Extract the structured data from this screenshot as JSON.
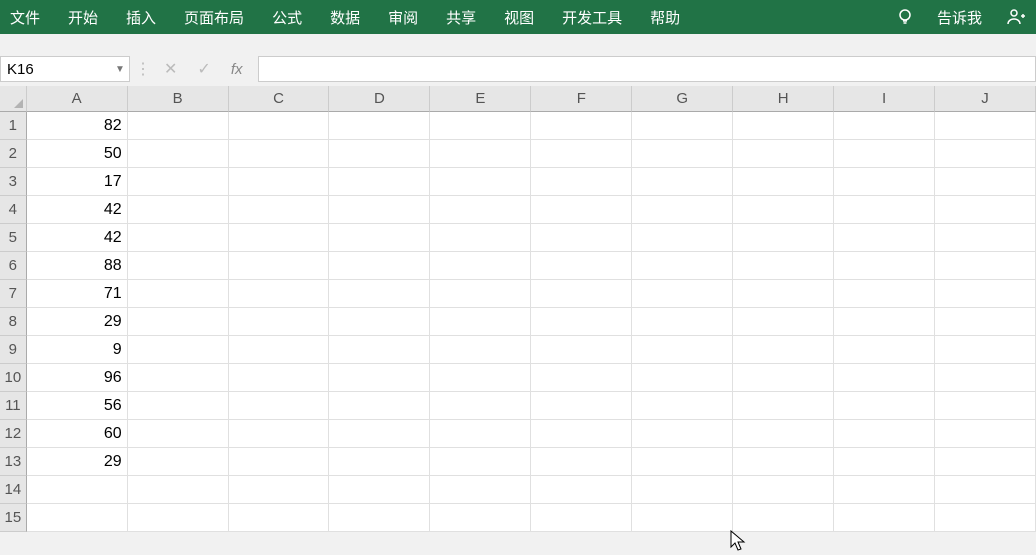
{
  "ribbon": {
    "tabs": [
      "文件",
      "开始",
      "插入",
      "页面布局",
      "公式",
      "数据",
      "审阅",
      "共享",
      "视图",
      "开发工具",
      "帮助"
    ],
    "tell_me": "告诉我"
  },
  "name_box": {
    "value": "K16"
  },
  "formula_bar": {
    "fx": "fx",
    "value": ""
  },
  "columns": [
    "A",
    "B",
    "C",
    "D",
    "E",
    "F",
    "G",
    "H",
    "I",
    "J"
  ],
  "rows": [
    "1",
    "2",
    "3",
    "4",
    "5",
    "6",
    "7",
    "8",
    "9",
    "10",
    "11",
    "12",
    "13",
    "14",
    "15"
  ],
  "cells": {
    "A1": "82",
    "A2": "50",
    "A3": "17",
    "A4": "42",
    "A5": "42",
    "A6": "88",
    "A7": "71",
    "A8": "29",
    "A9": "9",
    "A10": "96",
    "A11": "56",
    "A12": "60",
    "A13": "29"
  }
}
